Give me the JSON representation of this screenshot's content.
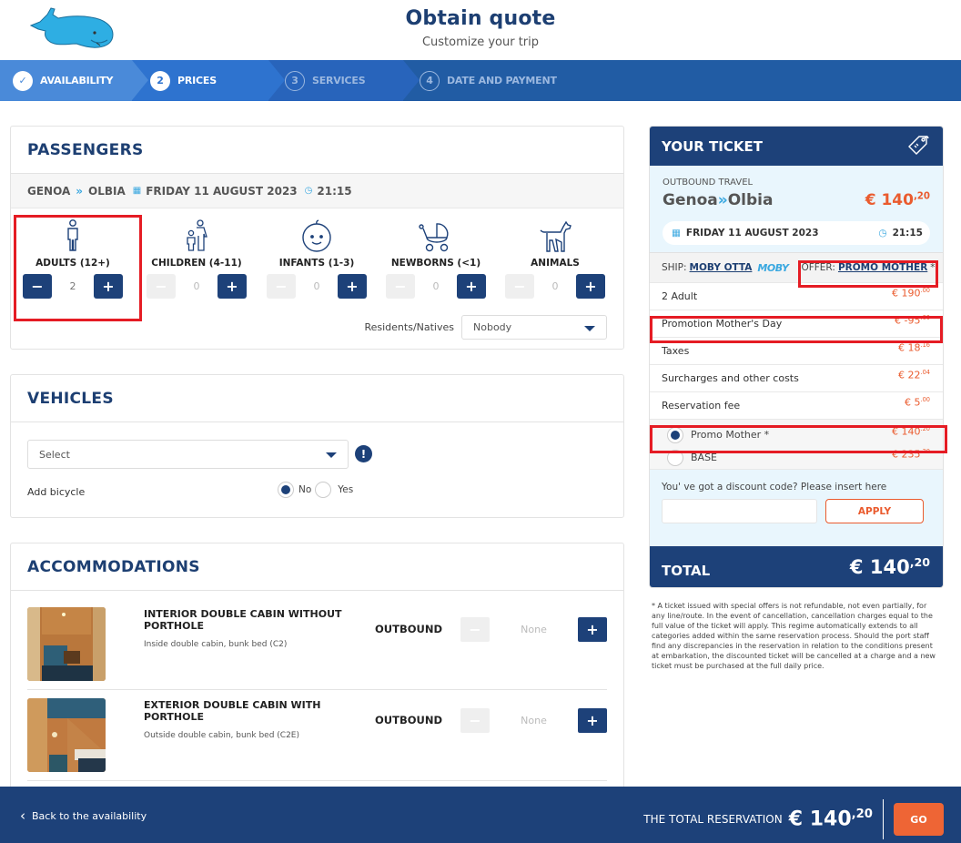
{
  "header": {
    "title": "Obtain quote",
    "subtitle": "Customize your trip"
  },
  "steps": [
    {
      "label": "AVAILABILITY",
      "number": "✓",
      "state": "done"
    },
    {
      "label": "PRICES",
      "number": "2",
      "state": "active"
    },
    {
      "label": "SERVICES",
      "number": "3",
      "state": "pending"
    },
    {
      "label": "DATE AND PAYMENT",
      "number": "4",
      "state": "pending"
    }
  ],
  "passengers": {
    "title": "PASSENGERS",
    "route": {
      "from": "GENOA",
      "to": "OLBIA",
      "date": "FRIDAY 11 AUGUST 2023",
      "time": "21:15"
    },
    "types": [
      {
        "label": "ADULTS (12+)",
        "count": "2",
        "icon": "adult-icon"
      },
      {
        "label": "CHILDREN (4-11)",
        "count": "0",
        "icon": "child-icon"
      },
      {
        "label": "INFANTS (1-3)",
        "count": "0",
        "icon": "infant-icon"
      },
      {
        "label": "NEWBORNS (<1)",
        "count": "0",
        "icon": "stroller-icon"
      },
      {
        "label": "ANIMALS",
        "count": "0",
        "icon": "dog-icon"
      }
    ],
    "residents_label": "Residents/Natives",
    "residents_value": "Nobody",
    "minus": "−",
    "plus": "+"
  },
  "vehicles": {
    "title": "VEHICLES",
    "select_value": "Select",
    "info": "!",
    "bicycle_label": "Add bicycle",
    "bicycle_options": [
      "No",
      "Yes"
    ],
    "bicycle_selected": "No"
  },
  "accommodations": {
    "title": "ACCOMMODATIONS",
    "items": [
      {
        "name": "INTERIOR DOUBLE CABIN WITHOUT PORTHOLE",
        "desc": "Inside double cabin, bunk bed (C2)",
        "direction": "OUTBOUND",
        "value": "None"
      },
      {
        "name": "EXTERIOR DOUBLE CABIN WITH PORTHOLE",
        "desc": "Outside double cabin, bunk bed (C2E)",
        "direction": "OUTBOUND",
        "value": "None"
      }
    ]
  },
  "ticket": {
    "title": "YOUR TICKET",
    "outbound_label": "OUTBOUND TRAVEL",
    "from": "Genoa",
    "to": "Olbia",
    "price_int": "€ 140",
    "price_dec": ",20",
    "date": "FRIDAY 11 AUGUST 2023",
    "time": "21:15",
    "ship_label": "SHIP:",
    "ship_name": "MOBY OTTA",
    "ship_brand": "MOBY",
    "offer_label": "OFFER:",
    "offer_name": "PROMO MOTHER",
    "offer_mark": "*",
    "lines": [
      {
        "label": "2 Adult",
        "int": "€ 190",
        "dec": ".00"
      },
      {
        "label": "Promotion Mother's Day",
        "int": "€ -95",
        "dec": ".00"
      },
      {
        "label": "Taxes",
        "int": "€ 18",
        "dec": ".16"
      },
      {
        "label": "Surcharges and other costs",
        "int": "€ 22",
        "dec": ".04"
      },
      {
        "label": "Reservation fee",
        "int": "€ 5",
        "dec": ".00"
      }
    ],
    "options": [
      {
        "label": "Promo Mother *",
        "int": "€ 140",
        "dec": ".20",
        "selected": true
      },
      {
        "label": "BASE",
        "int": "€ 235",
        "dec": ".20",
        "selected": false
      }
    ],
    "discount_text": "You' ve got a discount code? Please insert here",
    "discount_value": "",
    "apply_label": "APPLY",
    "total_label": "TOTAL",
    "total_int": "€ 140",
    "total_dec": ",20"
  },
  "note": "* A ticket issued with special offers is not refundable, not even partially, for any line/route. In the event of cancellation, cancellation charges equal to the full value of the ticket will apply. This regime automatically extends to all categories added within the same reservation process. Should the port staff find any discrepancies in the reservation in relation to the conditions present at embarkation, the discounted ticket will be cancelled at a charge and a new ticket must be purchased at the full daily price.",
  "footer": {
    "back_label": "Back to the availability",
    "total_label": "THE TOTAL RESERVATION",
    "total_int": "€ 140",
    "total_dec": ",20",
    "go_label": "GO"
  },
  "colors": {
    "primary": "#1d4179",
    "accent": "#ea5b2e",
    "highlight": "#e51c24",
    "link": "#3aa8e0"
  }
}
